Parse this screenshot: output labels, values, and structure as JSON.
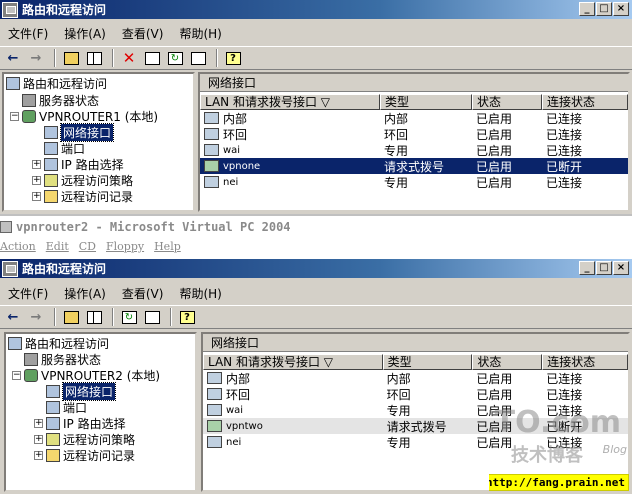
{
  "window_top": {
    "title": "路由和远程访问",
    "menu": [
      "文件(F)",
      "操作(A)",
      "查看(V)",
      "帮助(H)"
    ],
    "tree": {
      "root": "路由和远程访问",
      "server_status": "服务器状态",
      "server": "VPNROUTER1 (本地)",
      "network_interfaces": "网络接口",
      "ports": "端口",
      "ip_routing": "IP 路由选择",
      "remote_access_policy": "远程访问策略",
      "remote_access_logging": "远程访问记录"
    },
    "pane_title": "网络接口",
    "columns": [
      "LAN 和请求拨号接口",
      "类型",
      "状态",
      "连接状态"
    ],
    "rows": [
      {
        "name": "内部",
        "type": "内部",
        "status": "已启用",
        "conn": "已连接"
      },
      {
        "name": "环回",
        "type": "环回",
        "status": "已启用",
        "conn": "已连接"
      },
      {
        "name": "wai",
        "type": "专用",
        "status": "已启用",
        "conn": "已连接"
      },
      {
        "name": "vpnone",
        "type": "请求式拨号",
        "status": "已启用",
        "conn": "已断开"
      },
      {
        "name": "nei",
        "type": "专用",
        "status": "已启用",
        "conn": "已连接"
      }
    ]
  },
  "vpc": {
    "title": "vpnrouter2 - Microsoft Virtual PC 2004",
    "menu": [
      "Action",
      "Edit",
      "CD",
      "Floppy",
      "Help"
    ]
  },
  "window_bottom": {
    "title": "路由和远程访问",
    "menu": [
      "文件(F)",
      "操作(A)",
      "查看(V)",
      "帮助(H)"
    ],
    "tree": {
      "root": "路由和远程访问",
      "server_status": "服务器状态",
      "server": "VPNROUTER2 (本地)",
      "network_interfaces": "网络接口",
      "ports": "端口",
      "ip_routing": "IP 路由选择",
      "remote_access_policy": "远程访问策略",
      "remote_access_logging": "远程访问记录"
    },
    "pane_title": "网络接口",
    "columns": [
      "LAN 和请求拨号接口",
      "类型",
      "状态",
      "连接状态"
    ],
    "rows": [
      {
        "name": "内部",
        "type": "内部",
        "status": "已启用",
        "conn": "已连接"
      },
      {
        "name": "环回",
        "type": "环回",
        "status": "已启用",
        "conn": "已连接"
      },
      {
        "name": "wai",
        "type": "专用",
        "status": "已启用",
        "conn": "已连接"
      },
      {
        "name": "vpntwo",
        "type": "请求式拨号",
        "status": "已启用",
        "conn": "已断开"
      },
      {
        "name": "nei",
        "type": "专用",
        "status": "已启用",
        "conn": "已连接"
      }
    ]
  },
  "watermark": {
    "brand": "51CTO.com",
    "sub": "技术博客",
    "blog": "Blog",
    "url": "http://fang.prain.net"
  }
}
